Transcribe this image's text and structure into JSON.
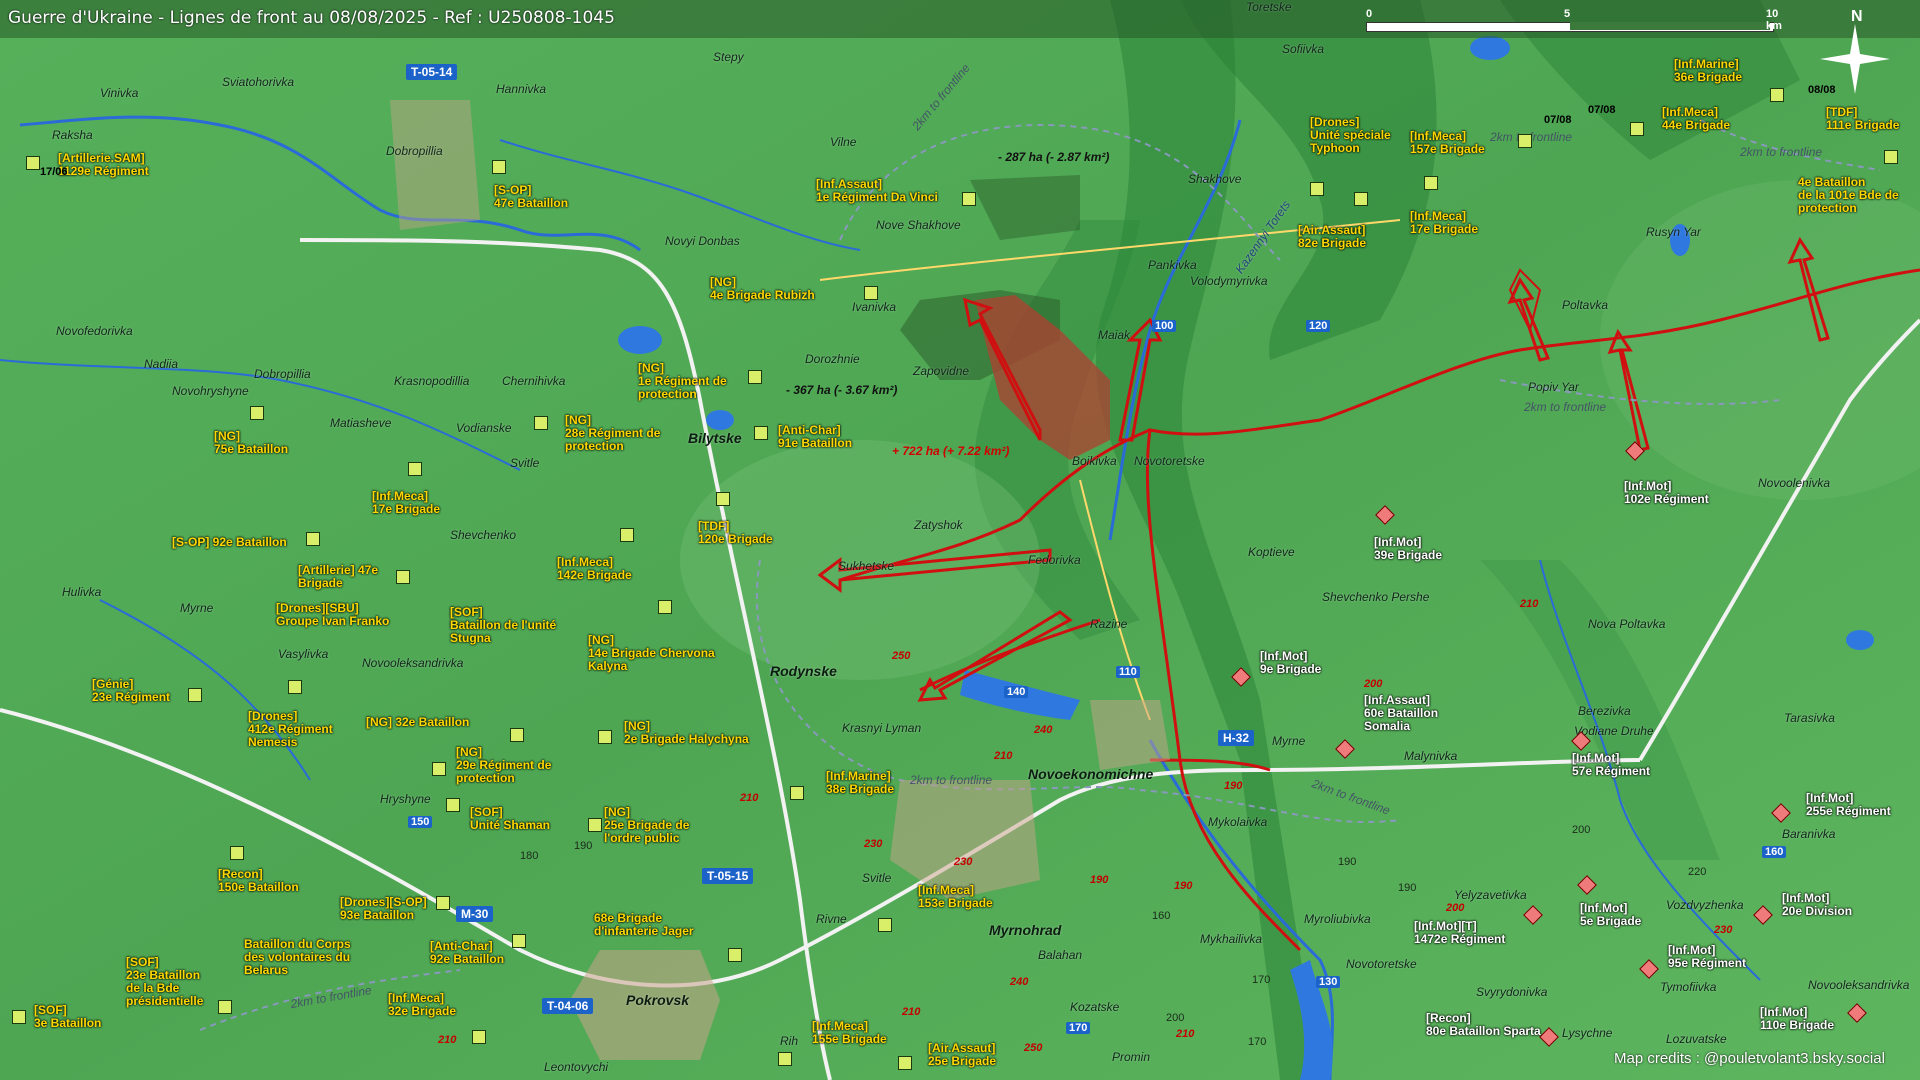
{
  "title": "Guerre d'Ukraine - Lignes de front au 08/08/2025 - Ref : U250808-1045",
  "credits": "Map credits : @pouletvolant3.bsky.social",
  "scale": {
    "labels": [
      "0",
      "5",
      "10 km"
    ]
  },
  "north": "N",
  "colors": {
    "terrain": "#4faa55",
    "front_line": "#d01010",
    "occupied": "#b04030",
    "friendly_unit": "#ffd800",
    "enemy_unit": "#ffffff",
    "route_shield": "#1b62c9"
  },
  "areas": [
    {
      "text": "- 287 ha (- 2.87 km²)"
    },
    {
      "text": "- 367 ha (- 3.67 km²)"
    },
    {
      "text": "+ 722 ha (+ 7.22 km²)"
    }
  ],
  "frontline_labels": [
    "2km to frontline",
    "2km to frontline",
    "2km to frontline",
    "2km to frontline",
    "2km to frontline",
    "2km to frontline",
    "2km to frontline"
  ],
  "places": [
    "Sviatohorivka",
    "Hannivka",
    "Stepy",
    "Vinivka",
    "Raksha",
    "Dobropillia",
    "Novyi Donbas",
    "Vilne",
    "Nove Shakhove",
    "Ivanivka",
    "Novofedorivka",
    "Nadiia",
    "Dobropillia",
    "Novohryshyne",
    "Krasnopodillia",
    "Chernihivka",
    "Dorozhnie",
    "Zapovidne",
    "Matiasheve",
    "Vodianske",
    "Svitle",
    "Bilytske",
    "Shevchenko",
    "Zatyshok",
    "Sukhetske",
    "Fedorivka",
    "Hulivka",
    "Myrne",
    "Vasylivka",
    "Novooleksandrivka",
    "Rodynske",
    "Krasnyi Lyman",
    "Hryshyne",
    "Svitle",
    "Rivne",
    "Myrnohrad",
    "Balahan",
    "Pokrovsk",
    "Leontovychi",
    "Rih",
    "Kozatske",
    "Promin",
    "Novoekonomichne",
    "Razine",
    "Mykolaivka",
    "Mykhailivka",
    "Myroliubivka",
    "Novotoretske",
    "Shakhove",
    "Pankivka",
    "Volodymyrivka",
    "Maiak",
    "Boikivka",
    "Novotoretske",
    "Koptieve",
    "Shevchenko Pershe",
    "Nova Poltavka",
    "Myrne",
    "Malynivka",
    "Berezivka",
    "Vodiane Druhe",
    "Tarasivka",
    "Baranivka",
    "Vozdvyzhenka",
    "Tymofiivka",
    "Novooleksandrivka",
    "Lozuvatske",
    "Lysychne",
    "Svyrydonivka",
    "Yelyzavetivka",
    "Sofiivka",
    "Toretske",
    "Rusyn Yar",
    "Poltavka",
    "Popiv Yar",
    "Novoolenivka",
    "Kazennyi Torets"
  ],
  "units_friendly": [
    "[Artillerie.SAM]\n1129e Régiment",
    "[S-OP]\n47e Bataillon",
    "[Inf.Assaut]\n1e Régiment Da Vinci",
    "[NG]\n4e Brigade Rubizh",
    "[NG]\n1e Régiment de\nprotection",
    "[NG]\n28e Régiment de\nprotection",
    "[Anti-Char]\n91e Bataillon",
    "[NG]\n75e Bataillon",
    "[Inf.Meca]\n17e Brigade",
    "[S-OP] 92e Bataillon",
    "[TDF]\n120e Brigade",
    "[Inf.Meca]\n142e Brigade",
    "[Artillerie] 47e\nBrigade",
    "[Drones][SBU]\nGroupe Ivan Franko",
    "[SOF]\nBataillon de l'unité\nStugna",
    "[NG]\n14e Brigade Chervona\nKalyna",
    "[Génie]\n23e Régiment",
    "[Drones]\n412e Régiment\nNemesis",
    "[NG] 32e Bataillon",
    "[NG]\n2e Brigade Halychyna",
    "[NG]\n29e Régiment de\nprotection",
    "[Inf.Marine]\n38e Brigade",
    "[SOF]\nUnité Shaman",
    "[NG]\n25e Brigade de\nl'ordre public",
    "[Recon]\n150e Bataillon",
    "[Drones][S-OP]\n93e Bataillon",
    "68e Brigade\nd'infanterie Jager",
    "[Inf.Meca]\n153e Brigade",
    "Bataillon du Corps\ndes volontaires du\nBelarus",
    "[Anti-Char]\n92e Bataillon",
    "[SOF]\n23e Bataillon\nde la Bde\nprésidentielle",
    "[SOF]\n3e Bataillon",
    "[Inf.Meca]\n32e Brigade",
    "[Inf.Meca]\n155e Brigade",
    "[Air.Assaut]\n25e Brigade",
    "[Drones]\nUnité spéciale\nTyphoon",
    "[Inf.Meca]\n157e Brigade",
    "[Inf.Meca]\n17e Brigade",
    "[Air.Assaut]\n82e Brigade",
    "[Inf.Marine]\n36e Brigade",
    "[Inf.Meca]\n44e Brigade",
    "[TDF]\n111e Brigade",
    "4e Bataillon\nde la 101e Bde de\nprotection"
  ],
  "units_enemy": [
    "[Inf.Mot]\n102e Régiment",
    "[Inf.Mot]\n39e Brigade",
    "[Inf.Mot]\n9e Brigade",
    "[Inf.Assaut]\n60e Bataillon\nSomalia",
    "[Inf.Mot]\n57e Régiment",
    "[Inf.Mot]\n255e Régiment",
    "[Inf.Mot]\n20e Division",
    "[Inf.Mot]\n5e Brigade",
    "[Inf.Mot][T]\n1472e Régiment",
    "[Inf.Mot]\n95e Régiment",
    "[Inf.Mot]\n110e Brigade",
    "[Recon]\n80e Bataillon Sparta"
  ],
  "dates": [
    "17/06",
    "07/08",
    "07/08",
    "08/08"
  ],
  "shields": [
    "T-05-14",
    "T-05-15",
    "M-30",
    "T-04-06",
    "H-32"
  ],
  "route_numbers": [
    "100",
    "120",
    "110",
    "140",
    "130",
    "160",
    "170",
    "150"
  ],
  "road_numbers": [
    "250",
    "210",
    "240",
    "230",
    "230",
    "210",
    "190",
    "190",
    "210",
    "240",
    "250",
    "210",
    "200",
    "210",
    "200",
    "190",
    "230",
    "210"
  ],
  "altitudes": [
    "180",
    "190",
    "200",
    "220",
    "190",
    "160",
    "170",
    "200",
    "190",
    "170"
  ]
}
